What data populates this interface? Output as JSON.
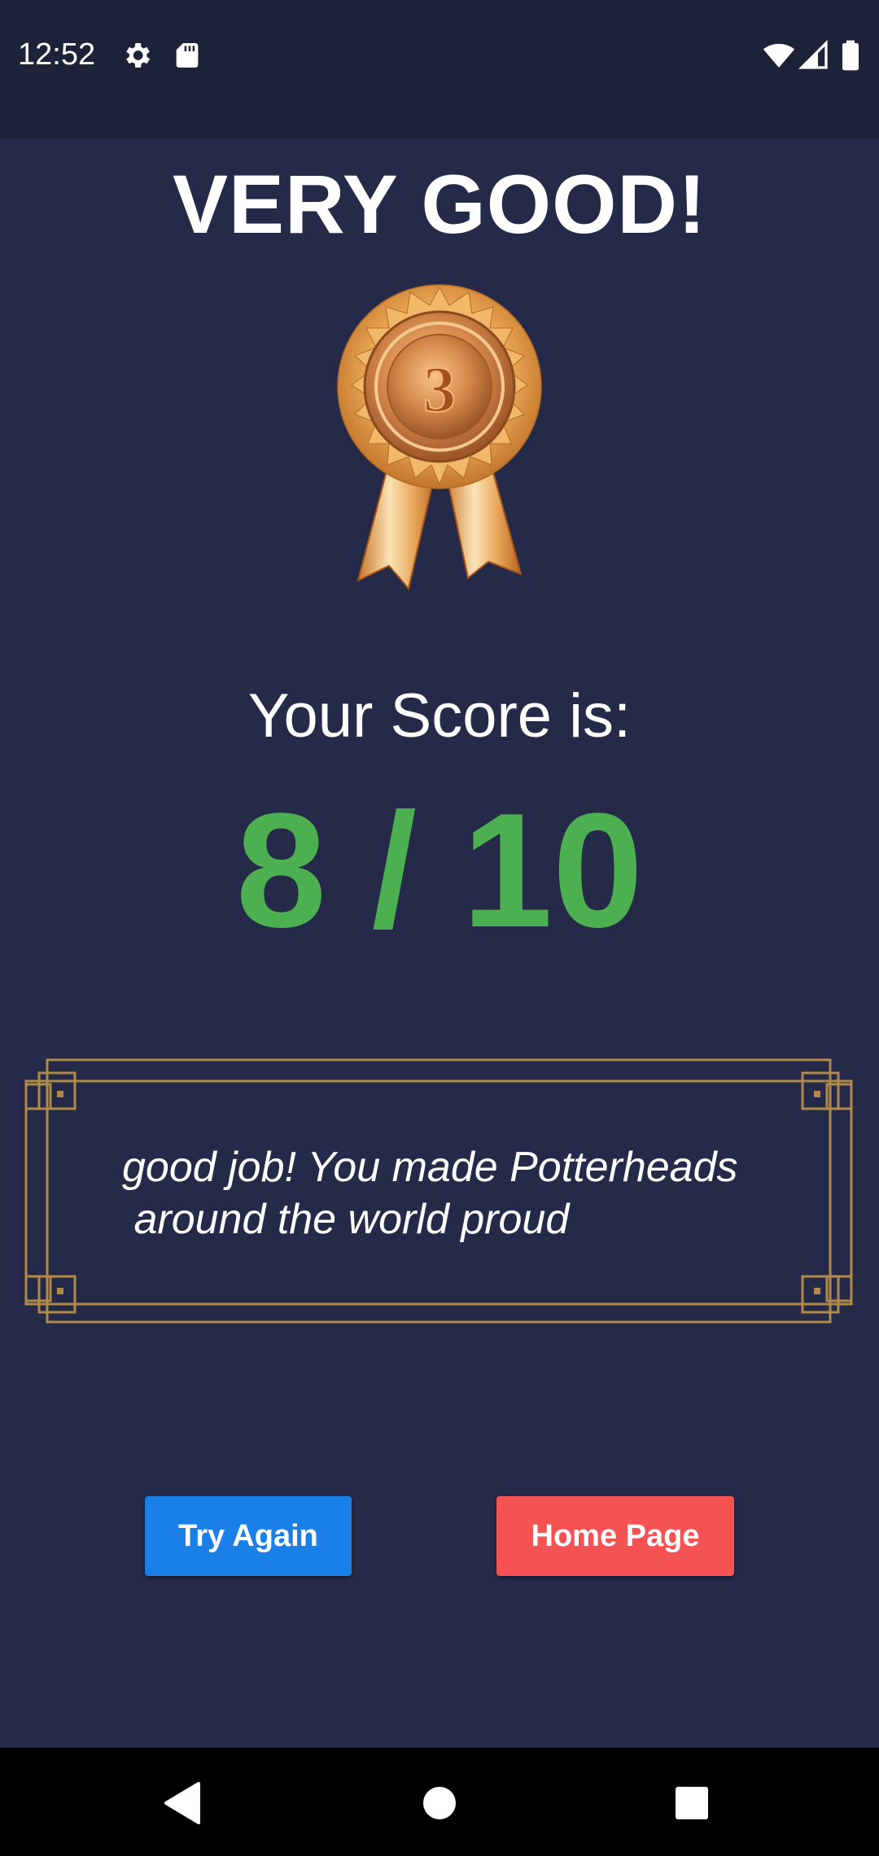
{
  "status_bar": {
    "time": "12:52",
    "icons": [
      "gear-icon",
      "sd-card-icon",
      "wifi-icon",
      "signal-icon",
      "battery-icon"
    ]
  },
  "result": {
    "headline": "VERY GOOD!",
    "medal_number": "3",
    "score_label": "Your Score is:",
    "score": "8 / 10",
    "score_color": "#4caf50",
    "message": "good job! You made Potterheads\n around the world proud"
  },
  "actions": {
    "try_again_label": "Try Again",
    "try_again_color": "#1a7fe6",
    "home_label": "Home Page",
    "home_color": "#f45253"
  },
  "nav_bar": {
    "icons": [
      "back-icon",
      "home-circle-icon",
      "recents-icon"
    ]
  }
}
